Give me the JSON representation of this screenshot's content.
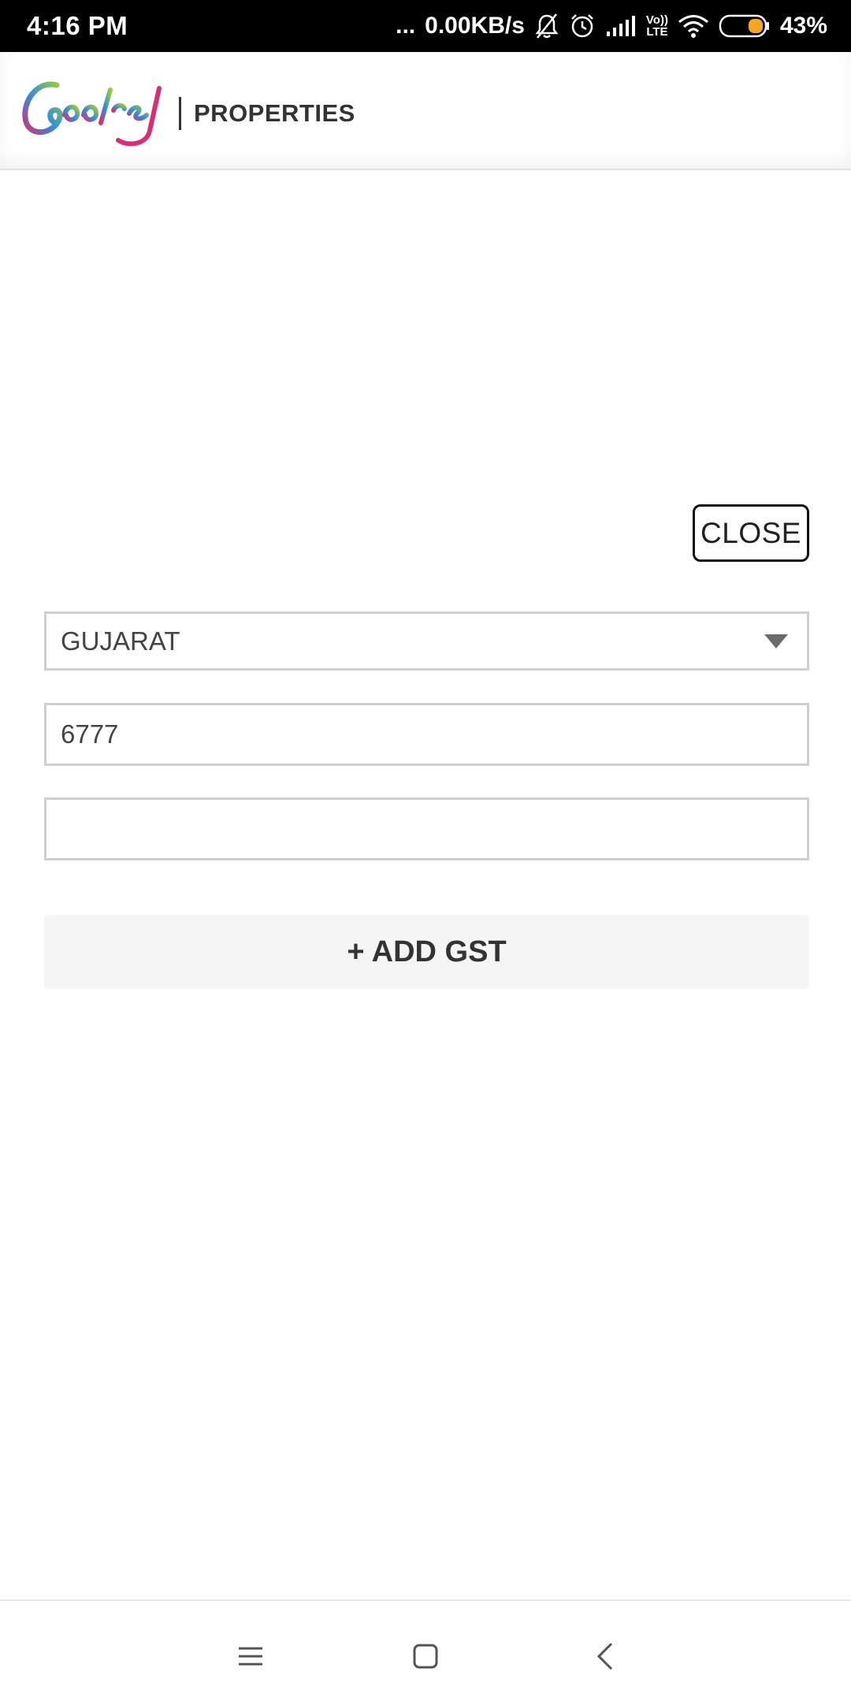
{
  "status_bar": {
    "time": "4:16 PM",
    "dots": "...",
    "network_speed": "0.00KB/s",
    "volte_top": "Vo))",
    "volte_bottom": "LTE",
    "battery": "43%",
    "battery_color": "#f5a623"
  },
  "header": {
    "logo_text": "PROPERTIES",
    "brand_colors": [
      "#9ccc3c",
      "#2f8fd8",
      "#d62f77"
    ]
  },
  "dialog": {
    "close_label": "CLOSE",
    "state_select": {
      "value": "GUJARAT"
    },
    "number_field": {
      "value": "6777"
    },
    "empty_field": {
      "value": ""
    },
    "add_gst_label": "+ ADD GST"
  },
  "nav_bar": {
    "icons": [
      "menu-icon",
      "home-square-icon",
      "back-chevron-icon"
    ]
  }
}
